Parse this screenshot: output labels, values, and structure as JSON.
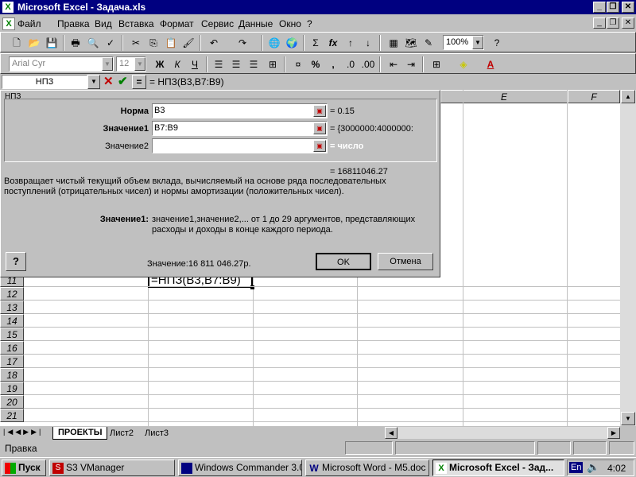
{
  "app": {
    "title": "Microsoft Excel - Задача.xls"
  },
  "menu": [
    "Файл",
    "Правка",
    "Вид",
    "Вставка",
    "Формат",
    "Сервис",
    "Данные",
    "Окно",
    "?"
  ],
  "toolbar2": {
    "font": "Arial Cyr",
    "size": "12",
    "zoom": "100%",
    "bold": "Ж",
    "italic": "К",
    "underline": "Ч"
  },
  "formula_bar": {
    "name_box": "НПЗ",
    "formula": "= НПЗ(B3,B7:B9)"
  },
  "grid": {
    "columns": [
      "E",
      "F"
    ],
    "rows": [
      "11",
      "12",
      "13",
      "14",
      "15",
      "16",
      "17",
      "18",
      "19",
      "20",
      "21"
    ],
    "active_cell_text": "=НПЗ(B3,B7:B9)"
  },
  "dialog": {
    "group_title": "НПЗ",
    "fields": [
      {
        "label": "Норма",
        "value": "B3",
        "result": "= 0.15",
        "bold": true
      },
      {
        "label": "Значение1",
        "value": "B7:B9",
        "result": "= {3000000:4000000:",
        "bold": true
      },
      {
        "label": "Значение2",
        "value": "",
        "result": "= число",
        "bold": false
      }
    ],
    "total": "= 16811046.27",
    "description": "Возвращает чистый текущий объем вклада, вычисляемый на основе ряда последовательных поступлений (отрицательных чисел) и нормы амортизации (положительных чисел).",
    "arg_name": "Значение1:",
    "arg_desc": "значение1,значение2,... от 1 до 29 аргументов, представляющих расходы и доходы в конце каждого периода.",
    "value_label": "Значение:16 811 046.27р.",
    "ok": "OK",
    "cancel": "Отмена",
    "help_icon": "?"
  },
  "sheets": {
    "tabs": [
      "ПРОЕКТЫ",
      "Лист2",
      "Лист3"
    ]
  },
  "status": "Правка",
  "taskbar": {
    "start": "Пуск",
    "tasks": [
      "S3 VManager",
      "Windows Commander 3.0...",
      "Microsoft Word - M5.doc",
      "Microsoft Excel - Зад..."
    ],
    "lang": "En",
    "clock": "4:02"
  },
  "colors": {
    "title_bg": "#000080",
    "grid_line": "#c0c0c0",
    "cancel_x": "#c00000",
    "enter_check": "#008000"
  }
}
